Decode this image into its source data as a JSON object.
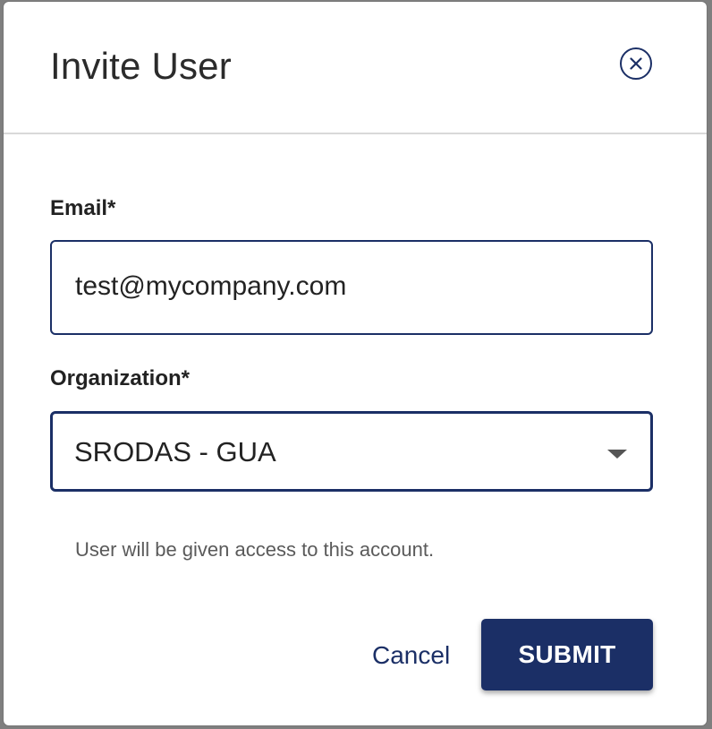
{
  "dialog": {
    "title": "Invite User",
    "close_icon": "close-circle-icon"
  },
  "form": {
    "email": {
      "label": "Email*",
      "value": "test@mycompany.com"
    },
    "organization": {
      "label": "Organization*",
      "selected": "SRODAS - GUA",
      "dropdown_icon": "chevron-down-icon"
    },
    "helper_text": "User will be given access to this account."
  },
  "actions": {
    "cancel_label": "Cancel",
    "submit_label": "SUBMIT"
  },
  "colors": {
    "accent": "#1b2f66",
    "divider": "#d9d9d9",
    "backdrop": "#7f7f7f"
  }
}
